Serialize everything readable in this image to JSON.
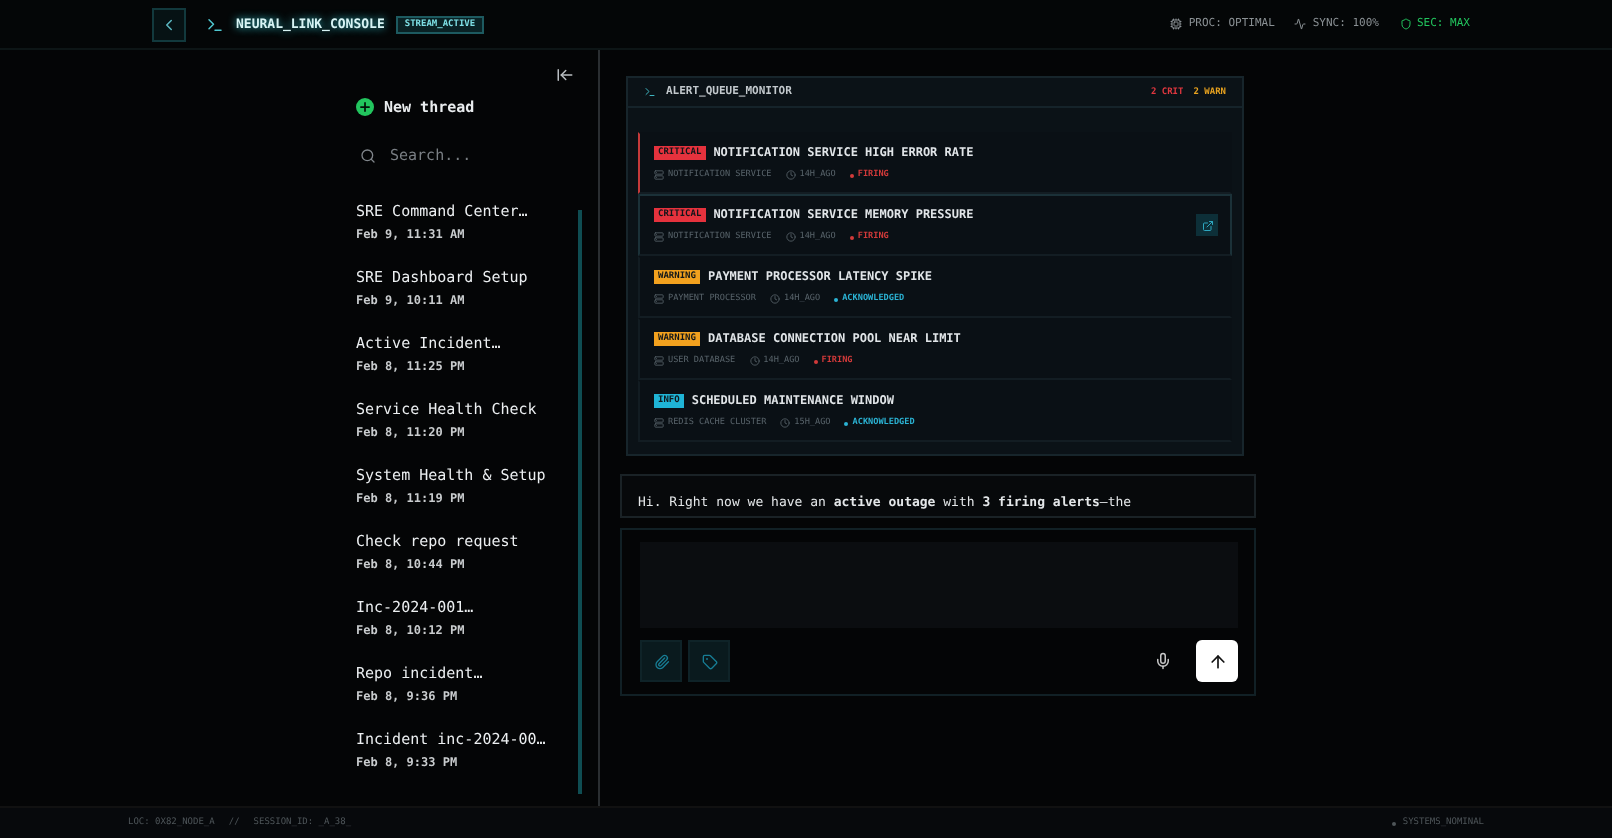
{
  "header": {
    "title": "NEURAL_LINK_CONSOLE",
    "badge": "STREAM_ACTIVE",
    "stats": [
      {
        "kind": "proc",
        "label": "PROC: OPTIMAL"
      },
      {
        "kind": "sync",
        "label": "SYNC: 100%"
      },
      {
        "kind": "sec",
        "label": "SEC: MAX"
      }
    ]
  },
  "sidebar": {
    "new_thread": "New thread",
    "search": {
      "placeholder": "Search..."
    },
    "threads": [
      {
        "title": "SRE Command Center…",
        "time": "Feb 9, 11:31 AM"
      },
      {
        "title": "SRE Dashboard Setup",
        "time": "Feb 9, 10:11 AM"
      },
      {
        "title": "Active Incident…",
        "time": "Feb 8, 11:25 PM"
      },
      {
        "title": "Service Health Check",
        "time": "Feb 8, 11:20 PM"
      },
      {
        "title": "System Health & Setup",
        "time": "Feb 8, 11:19 PM"
      },
      {
        "title": "Check repo request",
        "time": "Feb 8, 10:44 PM"
      },
      {
        "title": "Inc-2024-001…",
        "time": "Feb 8, 10:12 PM"
      },
      {
        "title": "Repo incident…",
        "time": "Feb 8, 9:36 PM"
      },
      {
        "title": "Incident inc-2024-00…",
        "time": "Feb 8, 9:33 PM"
      }
    ]
  },
  "alert_panel": {
    "title": "ALERT_QUEUE_MONITOR",
    "counts": [
      {
        "kind": "crit",
        "label": "2 CRIT"
      },
      {
        "kind": "warn",
        "label": "2 WARN"
      }
    ],
    "alerts": [
      {
        "badge": "CRITICAL",
        "color": "#e5323d",
        "title": "NOTIFICATION SERVICE HIGH ERROR RATE",
        "service": "NOTIFICATION SERVICE",
        "age": "14H_AGO",
        "status": {
          "label": "FIRING",
          "color": "#d23a3a"
        },
        "flagged": true,
        "selected": false
      },
      {
        "badge": "CRITICAL",
        "color": "#e5323d",
        "title": "NOTIFICATION SERVICE MEMORY PRESSURE",
        "service": "NOTIFICATION SERVICE",
        "age": "14H_AGO",
        "status": {
          "label": "FIRING",
          "color": "#d23a3a"
        },
        "flagged": false,
        "selected": true
      },
      {
        "badge": "WARNING",
        "color": "#f2a11e",
        "title": "PAYMENT PROCESSOR LATENCY SPIKE",
        "service": "PAYMENT PROCESSOR",
        "age": "14H_AGO",
        "status": {
          "label": "ACKNOWLEDGED",
          "color": "#2bb3d4"
        },
        "flagged": false,
        "selected": false
      },
      {
        "badge": "WARNING",
        "color": "#f2a11e",
        "title": "DATABASE CONNECTION POOL NEAR LIMIT",
        "service": "USER DATABASE",
        "age": "14H_AGO",
        "status": {
          "label": "FIRING",
          "color": "#d23a3a"
        },
        "flagged": false,
        "selected": false
      },
      {
        "badge": "INFO",
        "color": "#1fb4d6",
        "title": "SCHEDULED MAINTENANCE WINDOW",
        "service": "REDIS CACHE CLUSTER",
        "age": "15H_AGO",
        "status": {
          "label": "ACKNOWLEDGED",
          "color": "#2bb3d4"
        },
        "flagged": false,
        "selected": false
      }
    ]
  },
  "message": "Hi. Right now we have an **active outage** with **3 firing alerts**—the",
  "footer": {
    "location": "LOC: 0X82_NODE_A",
    "separator": "//",
    "session": "SESSION_ID: _A_38_",
    "status": "SYSTEMS_NOMINAL"
  }
}
